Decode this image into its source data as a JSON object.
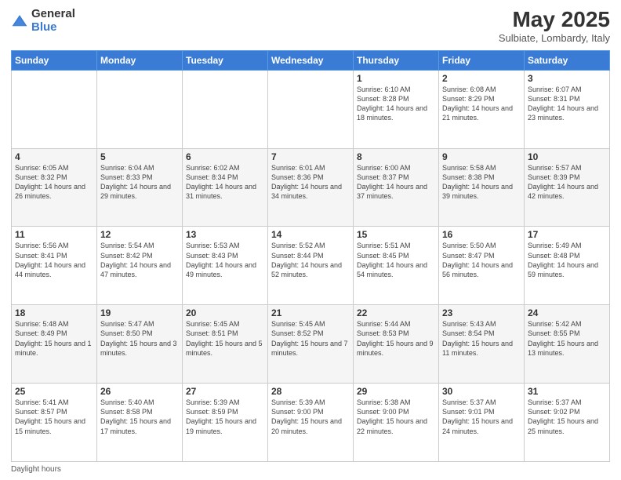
{
  "logo": {
    "general": "General",
    "blue": "Blue"
  },
  "header": {
    "month": "May 2025",
    "location": "Sulbiate, Lombardy, Italy"
  },
  "weekdays": [
    "Sunday",
    "Monday",
    "Tuesday",
    "Wednesday",
    "Thursday",
    "Friday",
    "Saturday"
  ],
  "footer": "Daylight hours",
  "weeks": [
    [
      {
        "day": "",
        "info": ""
      },
      {
        "day": "",
        "info": ""
      },
      {
        "day": "",
        "info": ""
      },
      {
        "day": "",
        "info": ""
      },
      {
        "day": "1",
        "info": "Sunrise: 6:10 AM\nSunset: 8:28 PM\nDaylight: 14 hours and 18 minutes."
      },
      {
        "day": "2",
        "info": "Sunrise: 6:08 AM\nSunset: 8:29 PM\nDaylight: 14 hours and 21 minutes."
      },
      {
        "day": "3",
        "info": "Sunrise: 6:07 AM\nSunset: 8:31 PM\nDaylight: 14 hours and 23 minutes."
      }
    ],
    [
      {
        "day": "4",
        "info": "Sunrise: 6:05 AM\nSunset: 8:32 PM\nDaylight: 14 hours and 26 minutes."
      },
      {
        "day": "5",
        "info": "Sunrise: 6:04 AM\nSunset: 8:33 PM\nDaylight: 14 hours and 29 minutes."
      },
      {
        "day": "6",
        "info": "Sunrise: 6:02 AM\nSunset: 8:34 PM\nDaylight: 14 hours and 31 minutes."
      },
      {
        "day": "7",
        "info": "Sunrise: 6:01 AM\nSunset: 8:36 PM\nDaylight: 14 hours and 34 minutes."
      },
      {
        "day": "8",
        "info": "Sunrise: 6:00 AM\nSunset: 8:37 PM\nDaylight: 14 hours and 37 minutes."
      },
      {
        "day": "9",
        "info": "Sunrise: 5:58 AM\nSunset: 8:38 PM\nDaylight: 14 hours and 39 minutes."
      },
      {
        "day": "10",
        "info": "Sunrise: 5:57 AM\nSunset: 8:39 PM\nDaylight: 14 hours and 42 minutes."
      }
    ],
    [
      {
        "day": "11",
        "info": "Sunrise: 5:56 AM\nSunset: 8:41 PM\nDaylight: 14 hours and 44 minutes."
      },
      {
        "day": "12",
        "info": "Sunrise: 5:54 AM\nSunset: 8:42 PM\nDaylight: 14 hours and 47 minutes."
      },
      {
        "day": "13",
        "info": "Sunrise: 5:53 AM\nSunset: 8:43 PM\nDaylight: 14 hours and 49 minutes."
      },
      {
        "day": "14",
        "info": "Sunrise: 5:52 AM\nSunset: 8:44 PM\nDaylight: 14 hours and 52 minutes."
      },
      {
        "day": "15",
        "info": "Sunrise: 5:51 AM\nSunset: 8:45 PM\nDaylight: 14 hours and 54 minutes."
      },
      {
        "day": "16",
        "info": "Sunrise: 5:50 AM\nSunset: 8:47 PM\nDaylight: 14 hours and 56 minutes."
      },
      {
        "day": "17",
        "info": "Sunrise: 5:49 AM\nSunset: 8:48 PM\nDaylight: 14 hours and 59 minutes."
      }
    ],
    [
      {
        "day": "18",
        "info": "Sunrise: 5:48 AM\nSunset: 8:49 PM\nDaylight: 15 hours and 1 minute."
      },
      {
        "day": "19",
        "info": "Sunrise: 5:47 AM\nSunset: 8:50 PM\nDaylight: 15 hours and 3 minutes."
      },
      {
        "day": "20",
        "info": "Sunrise: 5:45 AM\nSunset: 8:51 PM\nDaylight: 15 hours and 5 minutes."
      },
      {
        "day": "21",
        "info": "Sunrise: 5:45 AM\nSunset: 8:52 PM\nDaylight: 15 hours and 7 minutes."
      },
      {
        "day": "22",
        "info": "Sunrise: 5:44 AM\nSunset: 8:53 PM\nDaylight: 15 hours and 9 minutes."
      },
      {
        "day": "23",
        "info": "Sunrise: 5:43 AM\nSunset: 8:54 PM\nDaylight: 15 hours and 11 minutes."
      },
      {
        "day": "24",
        "info": "Sunrise: 5:42 AM\nSunset: 8:55 PM\nDaylight: 15 hours and 13 minutes."
      }
    ],
    [
      {
        "day": "25",
        "info": "Sunrise: 5:41 AM\nSunset: 8:57 PM\nDaylight: 15 hours and 15 minutes."
      },
      {
        "day": "26",
        "info": "Sunrise: 5:40 AM\nSunset: 8:58 PM\nDaylight: 15 hours and 17 minutes."
      },
      {
        "day": "27",
        "info": "Sunrise: 5:39 AM\nSunset: 8:59 PM\nDaylight: 15 hours and 19 minutes."
      },
      {
        "day": "28",
        "info": "Sunrise: 5:39 AM\nSunset: 9:00 PM\nDaylight: 15 hours and 20 minutes."
      },
      {
        "day": "29",
        "info": "Sunrise: 5:38 AM\nSunset: 9:00 PM\nDaylight: 15 hours and 22 minutes."
      },
      {
        "day": "30",
        "info": "Sunrise: 5:37 AM\nSunset: 9:01 PM\nDaylight: 15 hours and 24 minutes."
      },
      {
        "day": "31",
        "info": "Sunrise: 5:37 AM\nSunset: 9:02 PM\nDaylight: 15 hours and 25 minutes."
      }
    ]
  ]
}
